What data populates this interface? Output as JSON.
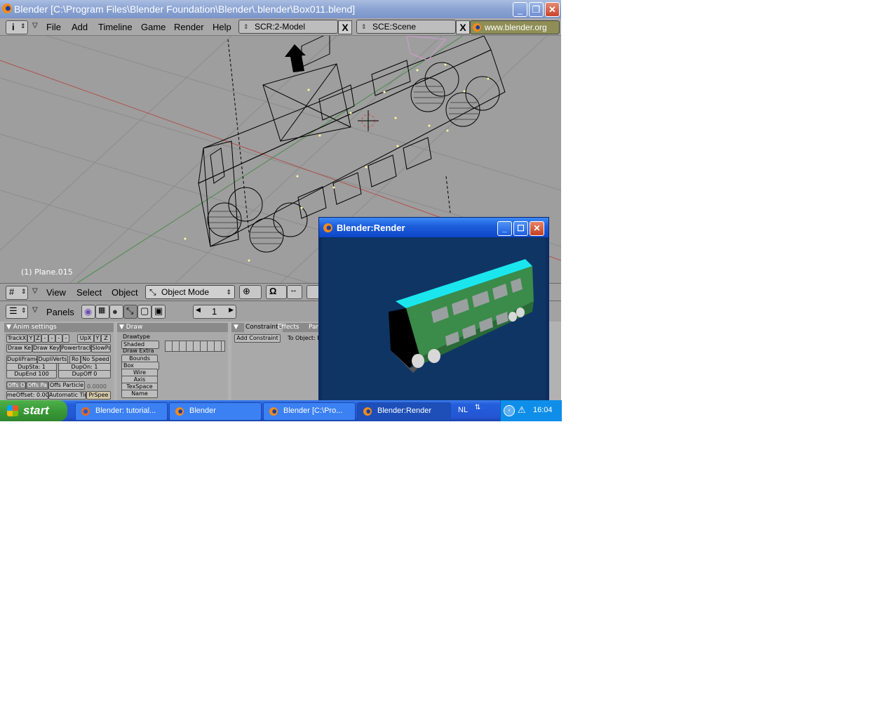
{
  "window": {
    "title": "Blender [C:\\Program Files\\Blender Foundation\\Blender\\.blender\\Box011.blend]",
    "minimize": "_",
    "restore": "❐",
    "close": "✕"
  },
  "menubar": {
    "items": [
      "File",
      "Add",
      "Timeline",
      "Game",
      "Render",
      "Help"
    ],
    "screen": "SCR:2-Model",
    "scene": "SCE:Scene",
    "url": "www.blender.org",
    "clear": "X"
  },
  "viewport": {
    "object_name": "(1) Plane.015"
  },
  "view3d_header": {
    "items": [
      "View",
      "Select",
      "Object"
    ],
    "mode": "Object Mode"
  },
  "buttons_header": {
    "panels_label": "Panels",
    "frame": "1"
  },
  "anim_panel": {
    "title": "Anim settings",
    "track_buttons": [
      "TrackX",
      "Y",
      "Z",
      "-",
      "-",
      "-",
      "-"
    ],
    "up_buttons": [
      "UpX",
      "Y",
      "Z"
    ],
    "row2": [
      "Draw Ke",
      "Draw Key",
      "Powertrack",
      "SlowPa"
    ],
    "row3": [
      "DupliFrame",
      "DupliVerts",
      "Ro",
      "No Speed"
    ],
    "dupsta": "DupSta: 1",
    "dupon": "DupOn: 1",
    "dupend": "DupEnd 100",
    "dupoff": "DupOff 0",
    "offs": [
      "Offs O",
      "Offs Pa",
      "Offs Particle"
    ],
    "timeoffset": "meOffset: 0.00",
    "automatic": "Automatic Tim",
    "prspeed": "PrSpee",
    "value": "0.0000"
  },
  "draw_panel": {
    "title": "Draw",
    "drawtype_label": "Drawtype",
    "drawtype": "Shaded",
    "drawextra_label": "Draw Extra",
    "bounds": "Bounds",
    "box": "Box",
    "options": [
      "Wire",
      "Axis",
      "TexSpace",
      "Name"
    ]
  },
  "constraint_panel": {
    "tabs": [
      "Constraints",
      "Effects",
      "Par"
    ],
    "add": "Add Constraint",
    "to_object": "To Object: P"
  },
  "render_window": {
    "title": "Blender:Render"
  },
  "taskbar": {
    "start": "start",
    "tasks": [
      {
        "label": "Blender: tutorial...",
        "active": false
      },
      {
        "label": "Blender",
        "active": false
      },
      {
        "label": "Blender [C:\\Pro...",
        "active": false
      },
      {
        "label": "Blender:Render",
        "active": true
      }
    ],
    "lang": "NL",
    "clock": "16:04"
  },
  "colors": {
    "viewport_bg": "#9e9e9e",
    "render_bg": "#0f3564",
    "bus_green": "#2e7a45",
    "bus_roof": "#14e0e8",
    "taskbar_blue": "#245edb",
    "start_green": "#3a9a38"
  }
}
